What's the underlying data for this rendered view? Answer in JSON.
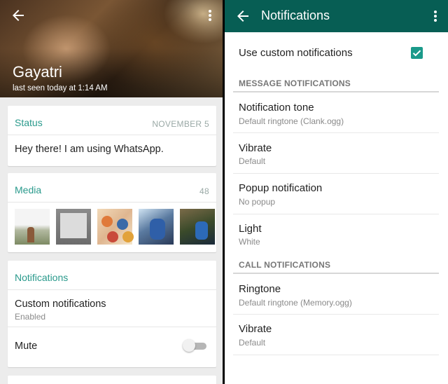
{
  "left": {
    "contact_name": "Gayatri",
    "last_seen": "last seen today at 1:14 AM",
    "back_icon": "arrow-left-icon",
    "menu_icon": "more-vert-icon",
    "status": {
      "title": "Status",
      "date": "NOVEMBER 5",
      "text": "Hey there! I am using WhatsApp."
    },
    "media": {
      "title": "Media",
      "count": "48"
    },
    "notifications": {
      "title": "Notifications",
      "custom_label": "Custom notifications",
      "custom_value": "Enabled",
      "mute_label": "Mute",
      "mute_on": false
    }
  },
  "right": {
    "title": "Notifications",
    "back_icon": "arrow-left-icon",
    "menu_icon": "more-vert-icon",
    "use_custom_label": "Use custom notifications",
    "use_custom_checked": true,
    "message_section": "MESSAGE NOTIFICATIONS",
    "call_section": "CALL NOTIFICATIONS",
    "items": [
      {
        "title": "Notification tone",
        "value": "Default ringtone (Clank.ogg)"
      },
      {
        "title": "Vibrate",
        "value": "Default"
      },
      {
        "title": "Popup notification",
        "value": "No popup"
      },
      {
        "title": "Light",
        "value": "White"
      },
      {
        "title": "Ringtone",
        "value": "Default ringtone (Memory.ogg)"
      },
      {
        "title": "Vibrate",
        "value": "Default"
      }
    ]
  },
  "colors": {
    "appbar": "#075e54",
    "accent": "#2a9a8c",
    "checkbox": "#1b9a8a"
  }
}
